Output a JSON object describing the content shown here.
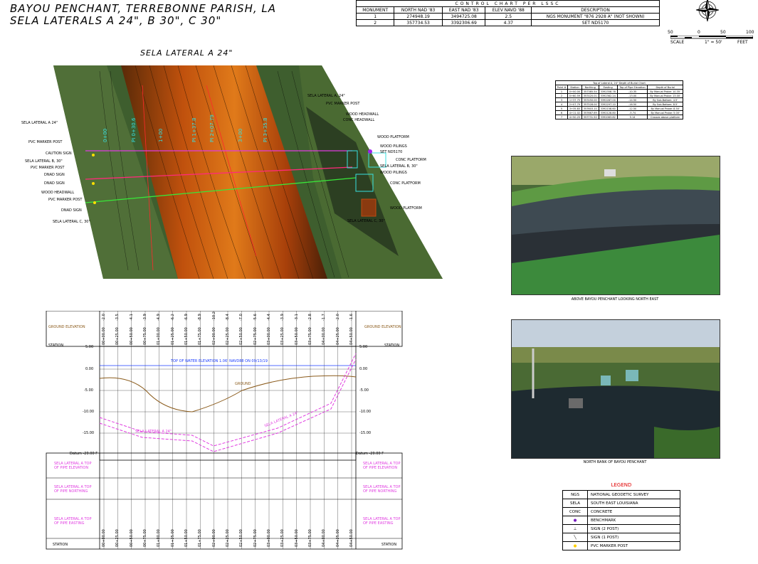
{
  "title": {
    "line1": "BAYOU PENCHANT, TERREBONNE PARISH, LA",
    "line2": "SELA LATERALS A 24\", B 30\", C 30\""
  },
  "control_chart": {
    "title": "CONTROL CHART PER LSSC",
    "headers": [
      "MONUMENT",
      "NORTH NAD '83",
      "EAST NAD '83",
      "ELEV NAVD '88",
      "DESCRIPTION"
    ],
    "rows": [
      [
        "1",
        "274948.19",
        "3494725.08",
        "2.5",
        "NGS MONUMENT \"876 2928 A\" (NOT SHOWN)"
      ],
      [
        "2",
        "357734.53",
        "3392306.69",
        "4.37",
        "SET ND5170"
      ]
    ]
  },
  "scale": {
    "ticks": [
      "50",
      "0",
      "50",
      "100"
    ],
    "label": "SCALE",
    "ratio": "1\" = 50'",
    "unit": "FEET"
  },
  "plan_view": {
    "title": "SELA LATERAL A 24\"",
    "labels_left": [
      "SELA LATERAL A 24\"",
      "PVC MARKER POST",
      "CAUTION SIGN",
      "SELA LATERAL B, 30\"",
      "PVC MARKER POST",
      "DNAD SIGN",
      "DNAD SIGN",
      "WOOD HEADWALL",
      "PVC MARKER POST",
      "DNAD SIGN",
      "SELA LATERAL C, 30\""
    ],
    "labels_right": [
      "SELA LATERAL A, 24\"",
      "PVC MARKER POST",
      "WOOD HEADWALL",
      "CONC HEADWALL",
      "WOOD PLATFORM",
      "WOOD PILINGS",
      "SET ND5170",
      "CONC PLATFORM",
      "SELA LATERAL B, 30\"",
      "WOOD PILINGS",
      "CONC PLATFORM",
      "WOOD PLATFORM",
      "SELA LATERAL C, 30\""
    ]
  },
  "burial_chart": {
    "title": "Top of Lateral A, 24\" Depth of Burial Chart",
    "headers": [
      "Point #",
      "Station",
      "Northing",
      "Easting",
      "Top of Pipe Elevation",
      "Depth of Burial"
    ],
    "rows": [
      [
        "1",
        "0+00.00",
        "357385.54",
        "3392358.78",
        "-10.35",
        "By Manual Probe: 10.35'"
      ],
      [
        "2",
        "0+60.59",
        "357420.01",
        "3392362.24",
        "-13.00",
        "By Manual Probe: 13.00'"
      ],
      [
        "3",
        "1+37.75",
        "357450.00",
        "3392287.00",
        "-14.50",
        "By Sub-Bottom: 4.5'"
      ],
      [
        "4",
        "2+07.79",
        "357528.00",
        "3392297.10",
        "-16.50",
        "By Sub-Bottom: 8.5'"
      ],
      [
        "5",
        "3+35.83",
        "357603.10",
        "3392158.60",
        "-12.50",
        "By Manual Probe: 8.50'"
      ],
      [
        "6",
        "4+11.02",
        "357667.69",
        "3392128.80",
        "-5.74",
        "By Manual Probe: 5.00'"
      ],
      [
        "7",
        "4+50.25",
        "357731.50",
        "3392063.82",
        "5.14",
        "Crosses above platform"
      ]
    ]
  },
  "photos": {
    "photo1_caption": "ABOVE BAYOU PENCHANT LOOKING NORTH EAST",
    "photo2_caption": "NORTH BANK OF BAYOU PENCHANT"
  },
  "profile": {
    "ground_elevation_label": "GROUND ELEVATION",
    "station_label": "STATION",
    "water_label": "TOP OF WATER ELEVATION 1.06' NAVD88 ON 09/13/19",
    "ground_label": "GROUND",
    "lateral_label": "SELA LATERAL A 24\"",
    "lateral_label2": "SELA LATERAL A 24\"",
    "datum_label": "Datum -20.00 F",
    "y_ticks": [
      "5.00",
      "0.00",
      "-5.00",
      "-10.00",
      "-15.00"
    ],
    "top_values": [
      "-2.0",
      "-3.5",
      "-4.1",
      "-3.9",
      "-4.9",
      "-6.2",
      "-6.9",
      "-8.9",
      "-10.2",
      "-8.4",
      "-7.0",
      "-5.6",
      "-4.4",
      "-3.9",
      "-3.1",
      "-2.8",
      "-1.7",
      "-2.0",
      "-1.6"
    ],
    "stations": [
      "00+00.00",
      "00+25.00",
      "00+50.00",
      "00+75.00",
      "01+00.00",
      "01+25.00",
      "01+50.00",
      "01+75.00",
      "02+00.00",
      "02+25.00",
      "02+50.00",
      "02+75.00",
      "03+00.00",
      "03+25.00",
      "03+50.00",
      "03+75.00",
      "04+00.00",
      "04+25.00",
      "04+50.00"
    ],
    "row_labels": [
      "SELA LATERAL A TOP OF PIPE ELEVATION",
      "SELA LATERAL A TOP OF PIPE NORTHING",
      "SELA LATERAL A TOP OF PIPE EASTING"
    ],
    "bottom_station_label": "STATION"
  },
  "legend": {
    "title": "LEGEND",
    "rows": [
      [
        "NGS",
        "NATIONAL GEODETIC SURVEY"
      ],
      [
        "SELA",
        "SOUTH EAST LOUISIANA"
      ],
      [
        "CONC",
        "CONCRETE"
      ],
      [
        "",
        "BENCHMARK"
      ],
      [
        "",
        "SIGN (2 POST)"
      ],
      [
        "",
        "SIGN (1 POST)"
      ],
      [
        "",
        "PVC MARKER POST"
      ]
    ]
  },
  "colors": {
    "lateral_a": "#e03ce0",
    "lateral_b": "#ff2a7a",
    "lateral_c": "#39e639",
    "water": "#1a3cff",
    "ground": "#8a5a1a",
    "legend_title": "#e00000"
  }
}
